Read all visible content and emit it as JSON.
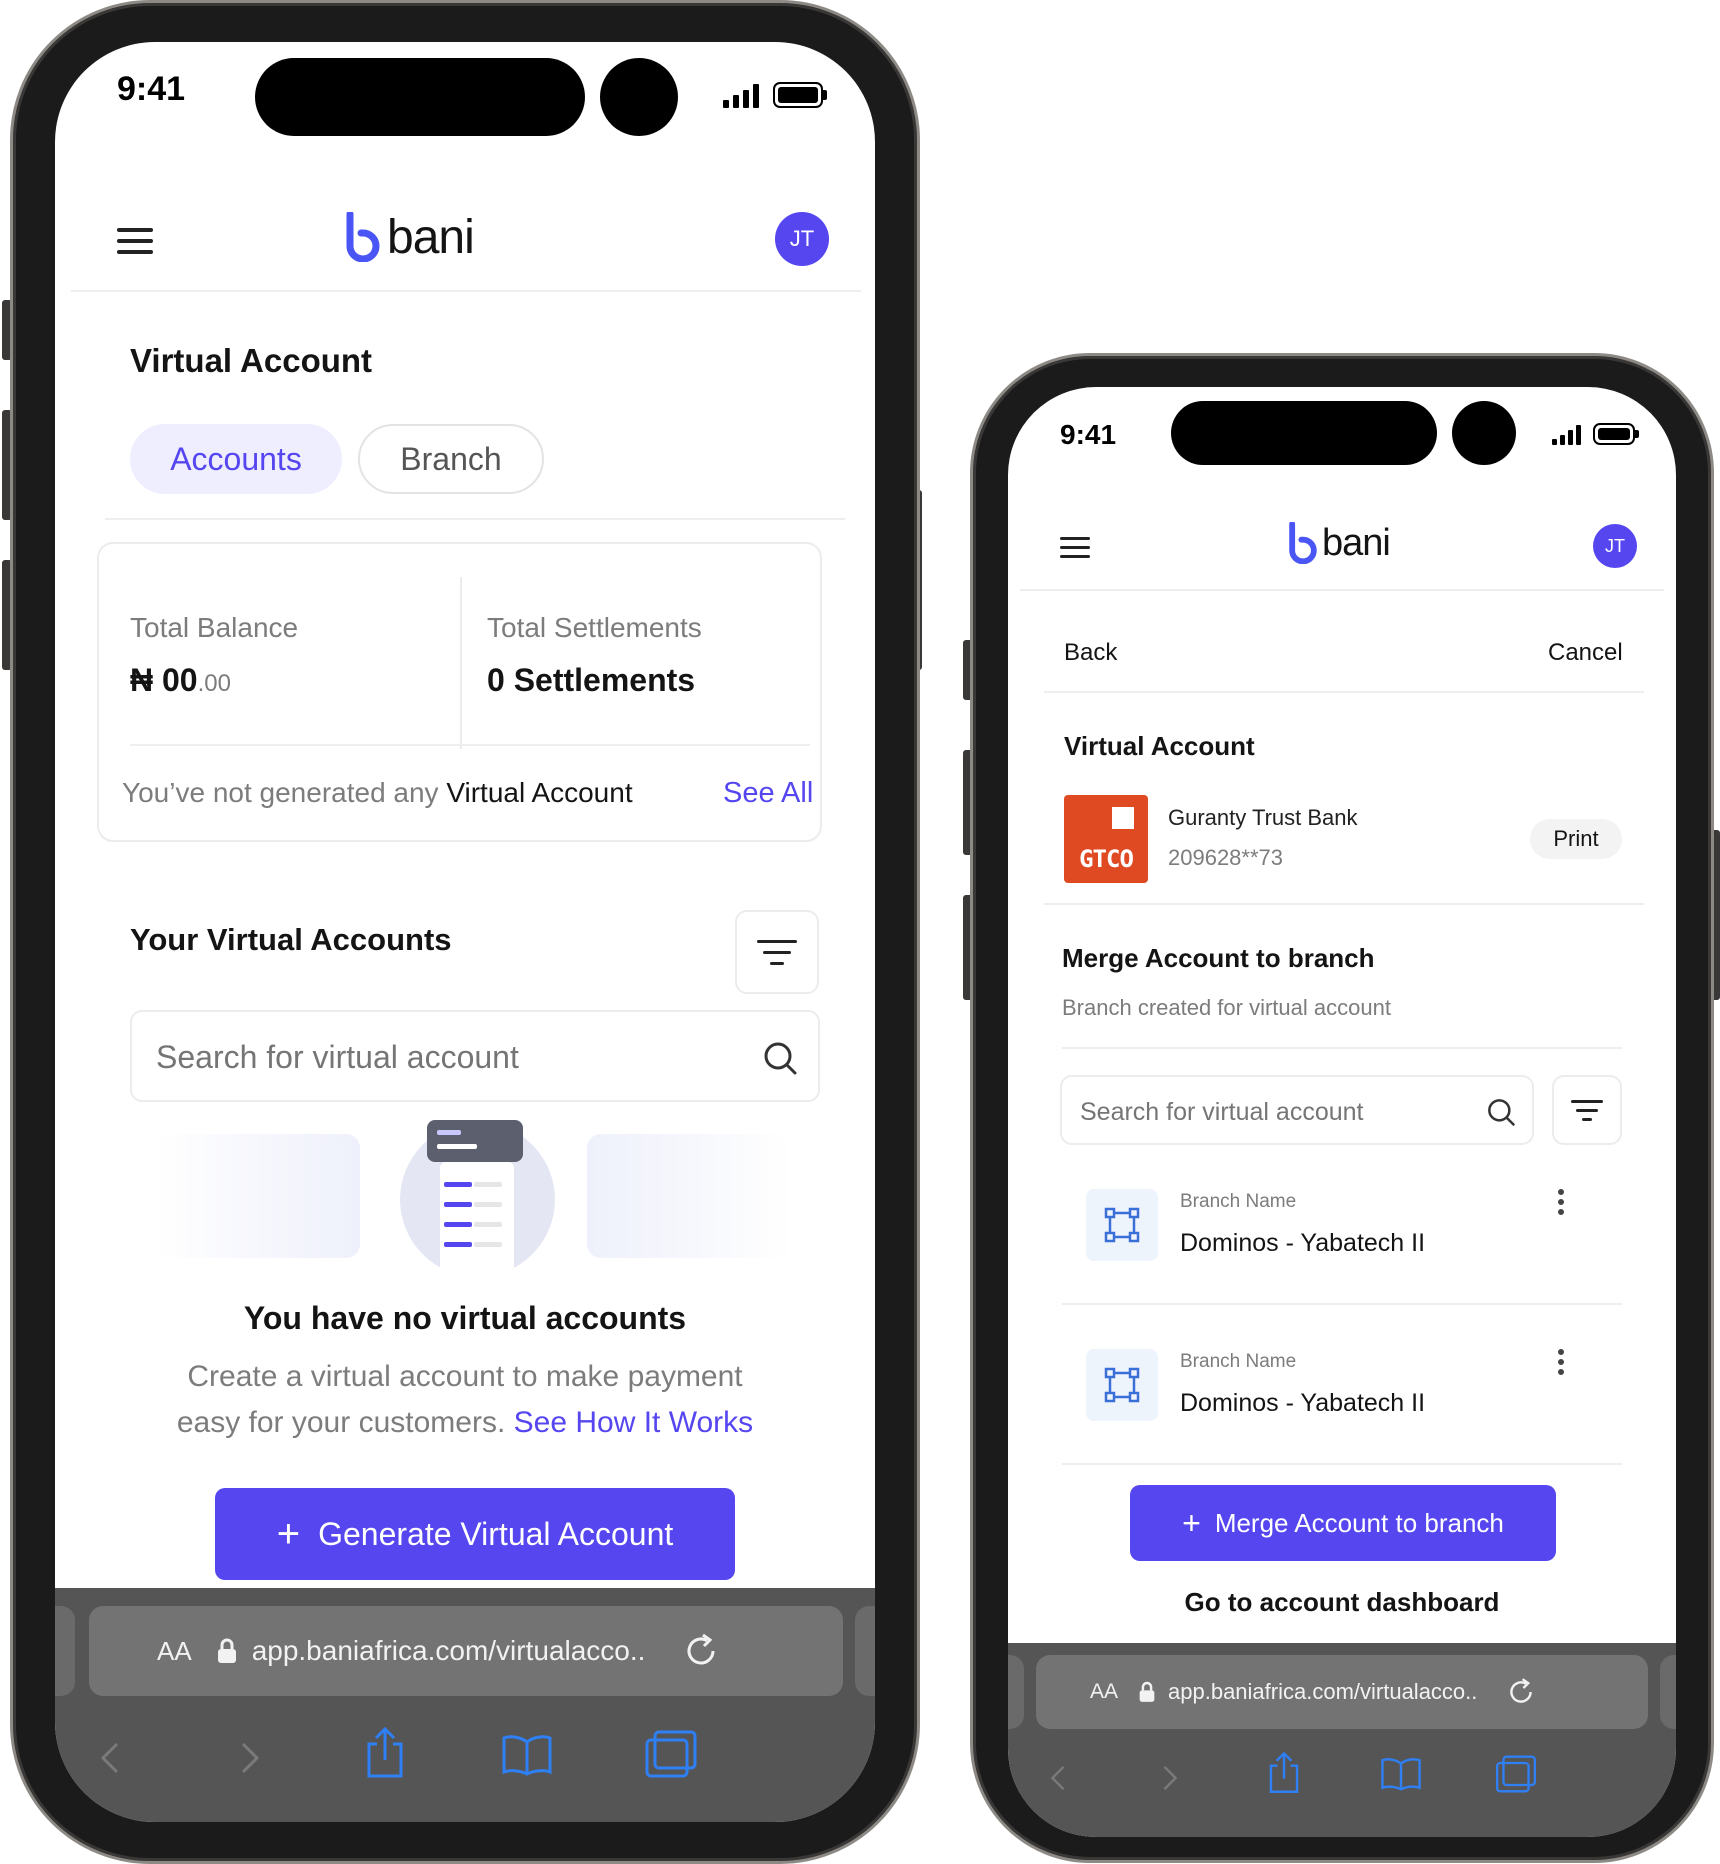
{
  "phone_left": {
    "status": {
      "time": "9:41"
    },
    "header": {
      "logo_text": "bani",
      "avatar_initials": "JT"
    },
    "page_title": "Virtual Account",
    "tabs": [
      {
        "label": "Accounts",
        "active": true
      },
      {
        "label": "Branch",
        "active": false
      }
    ],
    "summary": {
      "balance_label": "Total Balance",
      "balance_currency": "₦",
      "balance_main": "00",
      "balance_decimal": ".00",
      "settlements_label": "Total Settlements",
      "settlements_value": "0 Settlements",
      "notice_prefix": "You’ve not generated any ",
      "notice_emphasis": "Virtual Account",
      "see_all": "See All"
    },
    "list": {
      "title": "Your Virtual Accounts",
      "search_placeholder": "Search for virtual account"
    },
    "empty_state": {
      "title": "You have no virtual accounts",
      "desc_line1": "Create a virtual account to make payment",
      "desc_line2": "easy for your customers.",
      "link": "See How It Works"
    },
    "cta": {
      "label": "Generate Virtual Account"
    },
    "browser": {
      "text_size": "AA",
      "url": "app.baniafrica.com/virtualacco.."
    }
  },
  "phone_right": {
    "status": {
      "time": "9:41"
    },
    "header": {
      "logo_text": "bani",
      "avatar_initials": "JT"
    },
    "nav": {
      "back": "Back",
      "cancel": "Cancel"
    },
    "section_title": "Virtual Account",
    "bank": {
      "logo_text": "GTCO",
      "name": "Guranty Trust Bank",
      "account_masked": "209628**73",
      "print_label": "Print"
    },
    "merge": {
      "title": "Merge Account to branch",
      "subtitle": "Branch created for virtual account",
      "search_placeholder": "Search for virtual account"
    },
    "branches": [
      {
        "label": "Branch Name",
        "name": "Dominos - Yabatech II"
      },
      {
        "label": "Branch Name",
        "name": "Dominos - Yabatech II"
      }
    ],
    "cta": {
      "label": "Merge Account to branch"
    },
    "dashboard_link": "Go to account dashboard",
    "browser": {
      "text_size": "AA",
      "url": "app.baniafrica.com/virtualacco.."
    }
  },
  "colors": {
    "brand": "#5546f0",
    "gtco": "#e04a23",
    "safari_bar": "#555555",
    "safari_icon": "#2f7ff5"
  }
}
